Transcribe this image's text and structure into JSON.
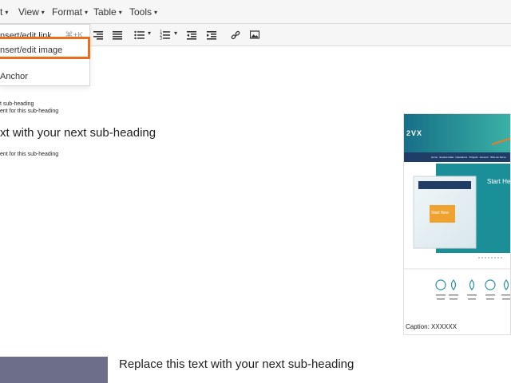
{
  "menubar": {
    "items": [
      {
        "label": "t",
        "caret": "▾"
      },
      {
        "label": "View",
        "caret": "▾"
      },
      {
        "label": "Format",
        "caret": "▾"
      },
      {
        "label": "Table",
        "caret": "▾"
      },
      {
        "label": "Tools",
        "caret": "▾"
      }
    ]
  },
  "dropdown": {
    "items": [
      {
        "label": "nsert/edit link",
        "shortcut": "⌘+K"
      },
      {
        "label": "nsert/edit image"
      },
      {
        "label": "Anchor"
      }
    ]
  },
  "content": {
    "small_heading": "t sub-heading",
    "small_body": "ent for this sub-heading",
    "heading": "xt with your next sub-heading",
    "body": "ent for this sub-heading",
    "caption": "Caption: XXXXXX",
    "bottom_heading": "Replace this text with your next sub-heading"
  },
  "preview": {
    "logo": "2VX",
    "banner_text": "Start Her",
    "button_text": "Start Now",
    "nav_items": [
      "Home",
      "Explore Data",
      "Operations",
      "Projects",
      "Account",
      "Who we Serve"
    ]
  },
  "colors": {
    "highlight": "#ee6d1d",
    "teal": "#1b8f97",
    "navy": "#1f3d66",
    "thumb": "#6d6e8a"
  }
}
